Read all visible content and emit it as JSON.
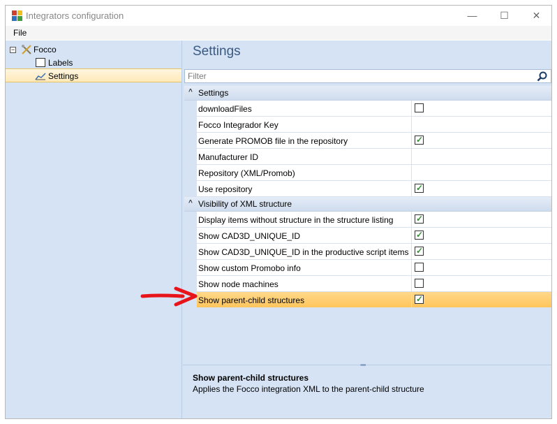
{
  "window": {
    "title": "Integrators configuration",
    "minimize": "—",
    "maximize": "☐",
    "close": "✕"
  },
  "menu": {
    "file": "File"
  },
  "tree": {
    "expander": "−",
    "root_label": "Focco",
    "items": [
      {
        "label": "Labels"
      },
      {
        "label": "Settings"
      }
    ]
  },
  "panel": {
    "title": "Settings",
    "filter_placeholder": "Filter"
  },
  "categories": [
    {
      "label": "Settings",
      "chevron": "^",
      "properties": [
        {
          "name": "downloadFiles",
          "type": "checkbox",
          "checked": false
        },
        {
          "name": "Focco Integrador Key",
          "type": "text",
          "value": ""
        },
        {
          "name": "Generate PROMOB file in the repository",
          "type": "checkbox",
          "checked": true
        },
        {
          "name": "Manufacturer ID",
          "type": "text",
          "value": ""
        },
        {
          "name": "Repository (XML/Promob)",
          "type": "text",
          "value": ""
        },
        {
          "name": "Use repository",
          "type": "checkbox",
          "checked": true
        }
      ]
    },
    {
      "label": "Visibility of XML structure",
      "chevron": "^",
      "properties": [
        {
          "name": "Display items without structure in the structure listing",
          "type": "checkbox",
          "checked": true
        },
        {
          "name": "Show CAD3D_UNIQUE_ID",
          "type": "checkbox",
          "checked": true
        },
        {
          "name": "Show CAD3D_UNIQUE_ID in the productive script items",
          "type": "checkbox",
          "checked": true
        },
        {
          "name": "Show custom Promobo info",
          "type": "checkbox",
          "checked": false
        },
        {
          "name": "Show node machines",
          "type": "checkbox",
          "checked": false
        },
        {
          "name": "Show parent-child structures",
          "type": "checkbox",
          "checked": true,
          "selected": true
        }
      ]
    }
  ],
  "description": {
    "title": "Show parent-child structures",
    "text": "Applies the Focco integration XML to the parent-child structure"
  },
  "colors": {
    "panel_bg": "#d5e3f4",
    "selection": "#ffc55c",
    "annotation_arrow": "#e8141c"
  }
}
